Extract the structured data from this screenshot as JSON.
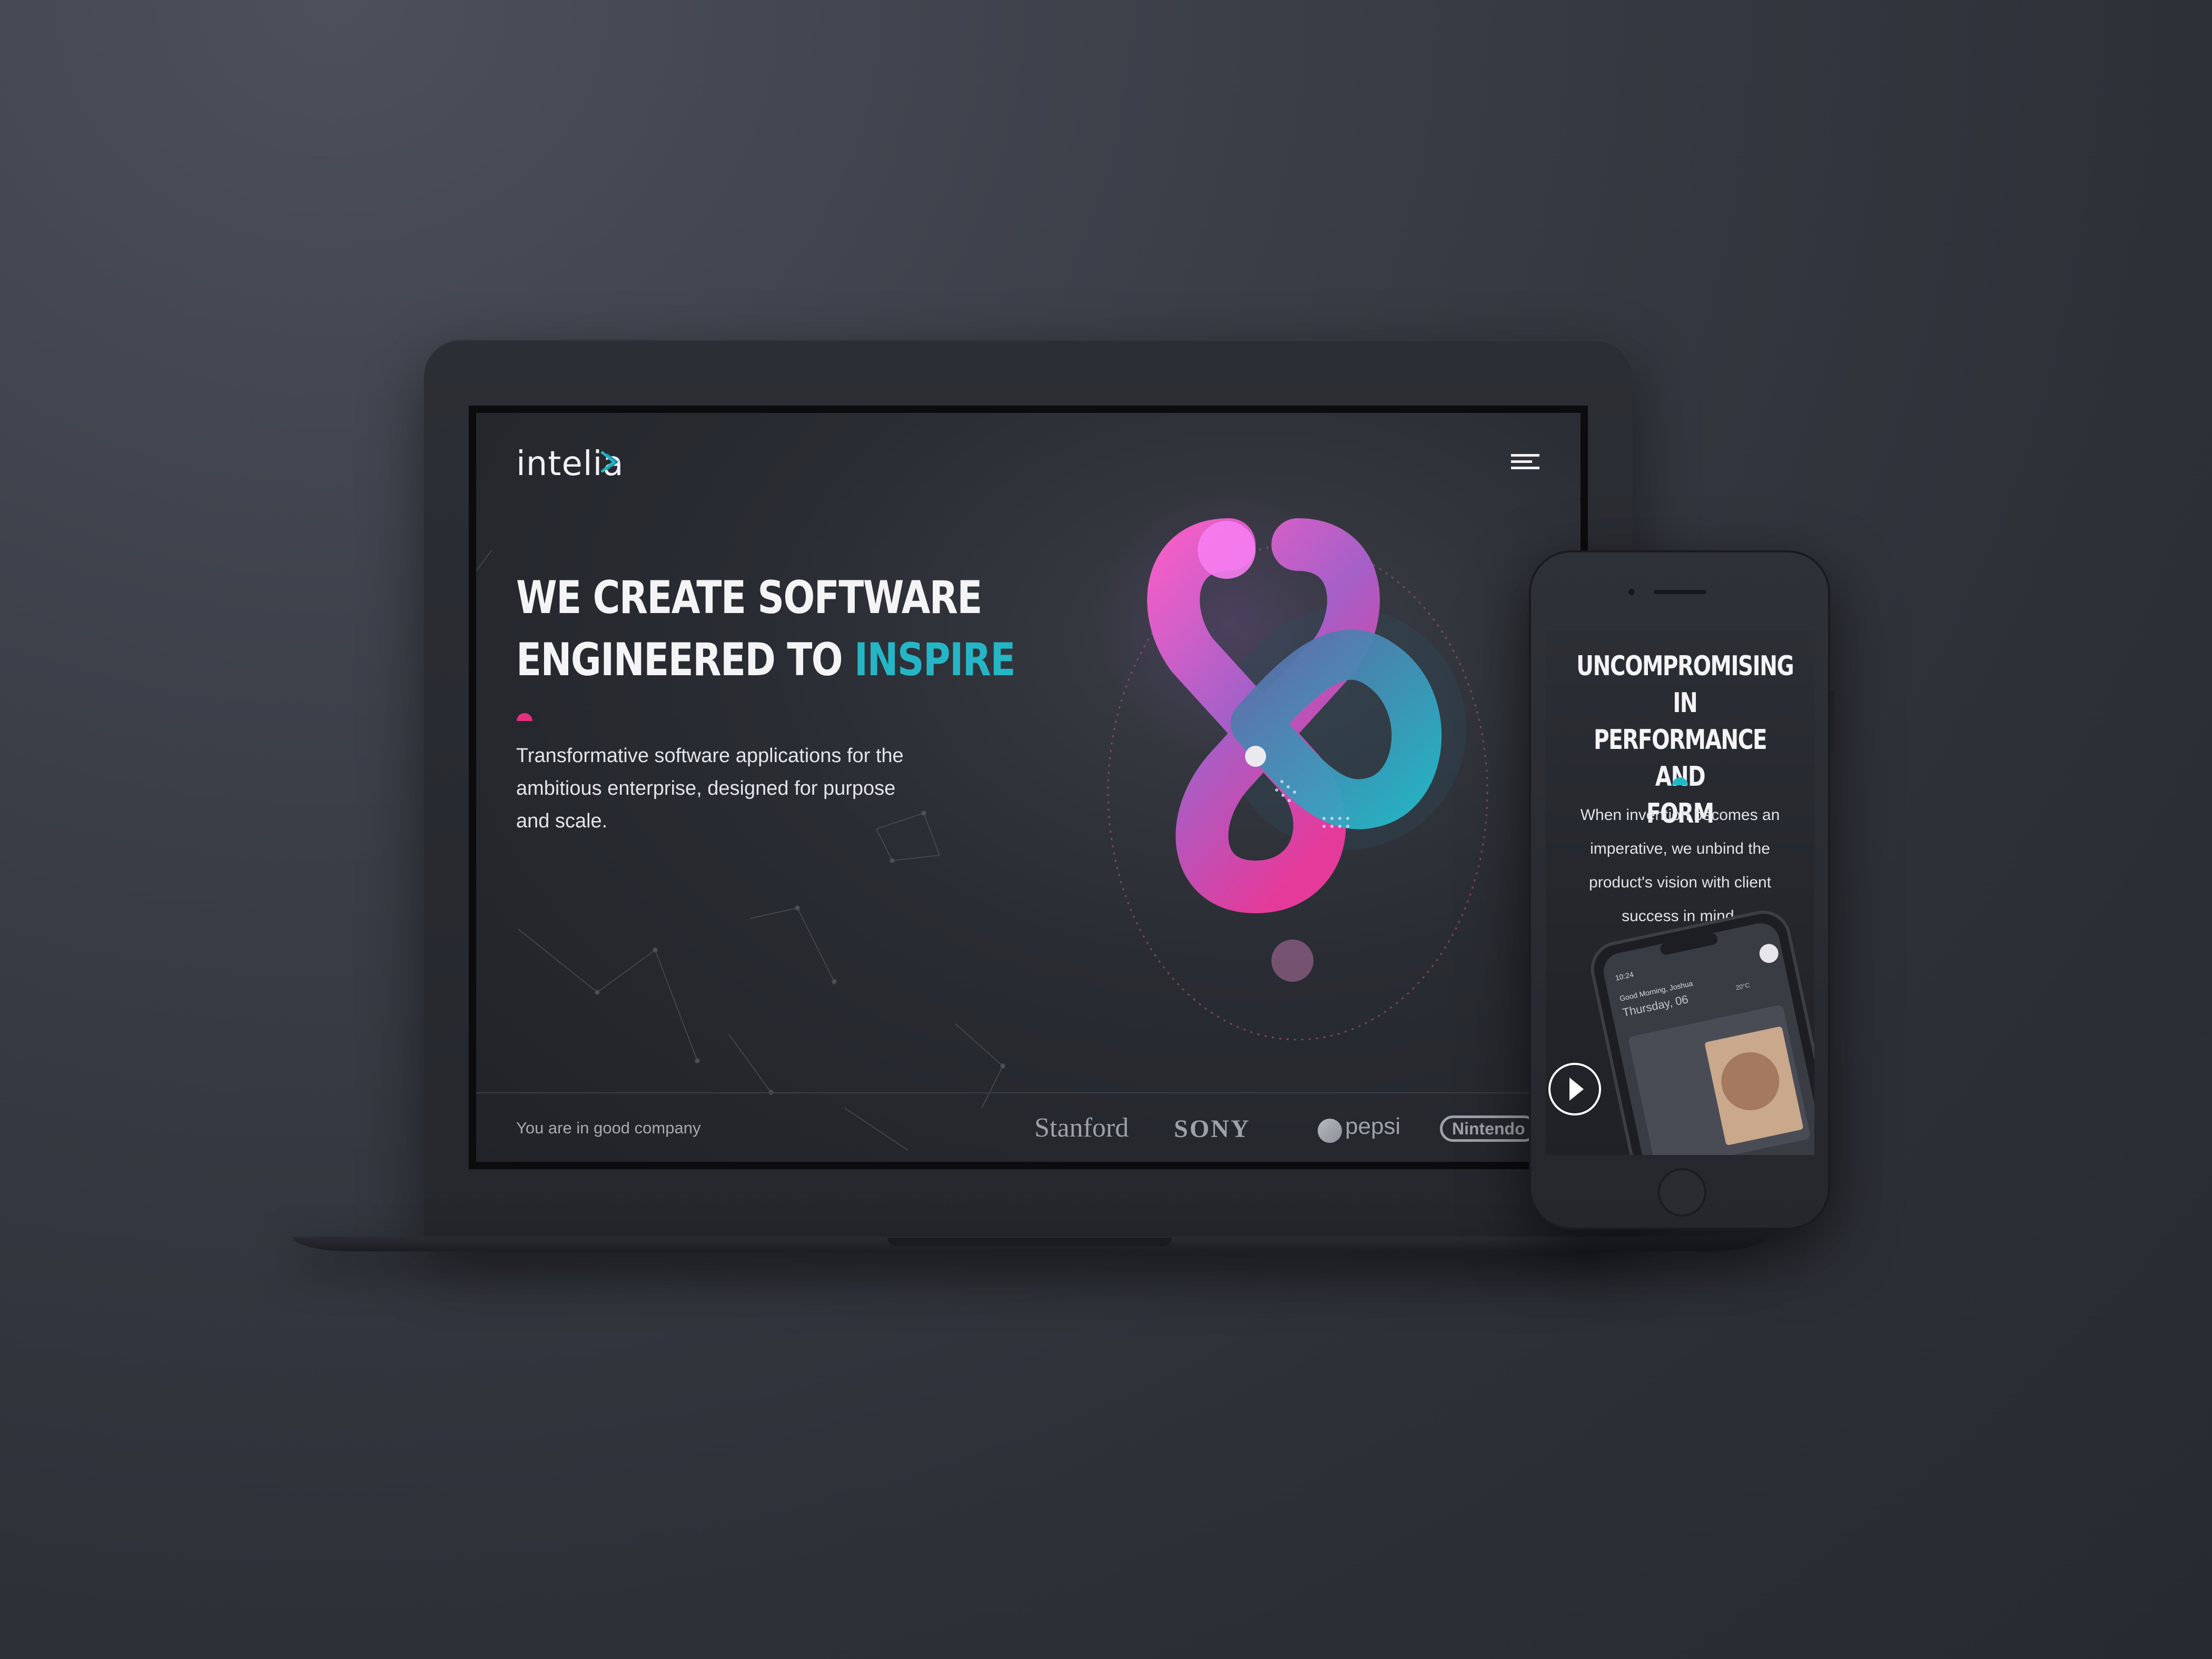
{
  "desktop": {
    "logo": "intelia",
    "hero": {
      "line1": "WE CREATE SOFTWARE",
      "line2_prefix": "ENGINEERED TO ",
      "line2_accent": "INSPIRE",
      "subtitle": "Transformative software applications for the ambitious enterprise, designed for purpose and scale."
    },
    "footer": {
      "tagline": "You are in good company",
      "brands": [
        "Stanford",
        "SONY",
        "pepsi",
        "Nintendo"
      ]
    }
  },
  "mobile": {
    "title": [
      "UNCOMPROMISING IN",
      "PERFORMANCE AND",
      "FORM"
    ],
    "subtitle": "When invention becomes an imperative, we unbind the product's vision with client success in mind.",
    "device_preview": {
      "time": "10:24",
      "greeting": "Good Morning, Joshua",
      "day": "Thursday, 06",
      "temperature": "20°C"
    }
  },
  "colors": {
    "accent_teal": "#25b6c6",
    "accent_pink": "#e6307f",
    "background": "#2e3038"
  }
}
